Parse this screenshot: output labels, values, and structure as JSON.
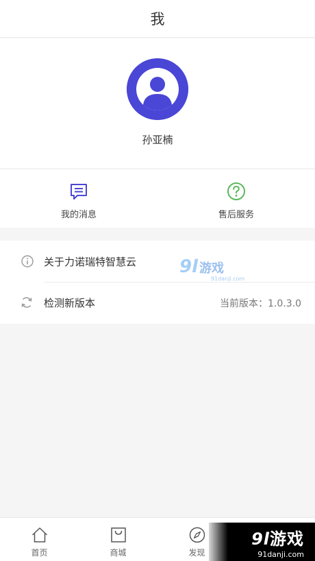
{
  "header": {
    "title": "我"
  },
  "profile": {
    "name": "孙亚楠",
    "avatar_color": "#4a46d6"
  },
  "quick_actions": [
    {
      "label": "我的消息",
      "icon": "message-icon",
      "color": "#4a46d6"
    },
    {
      "label": "售后服务",
      "icon": "question-circle-icon",
      "color": "#5cb85c"
    }
  ],
  "settings": {
    "about_label": "关于力诺瑞特智慧云",
    "update_label": "检测新版本",
    "version_text": "当前版本：1.0.3.0"
  },
  "watermark": {
    "logo": "9l",
    "name": "游戏",
    "url": "91danji.com"
  },
  "tabs": [
    {
      "label": "首页",
      "icon": "home-icon"
    },
    {
      "label": "商城",
      "icon": "shopping-bag-icon"
    },
    {
      "label": "发现",
      "icon": "compass-icon"
    }
  ],
  "badge": {
    "logo": "9l",
    "name": "游戏",
    "url": "91danji.com"
  }
}
